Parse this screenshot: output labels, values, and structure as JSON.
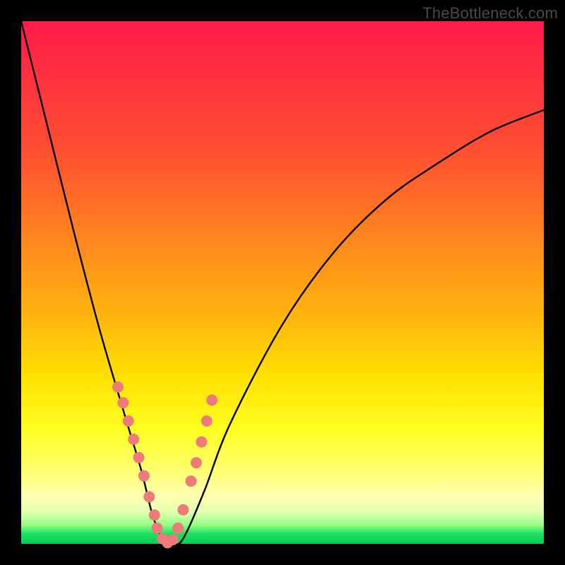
{
  "watermark": "TheBottleneck.com",
  "chart_data": {
    "type": "line",
    "title": "",
    "xlabel": "",
    "ylabel": "",
    "xlim": [
      0,
      100
    ],
    "ylim": [
      0,
      100
    ],
    "series": [
      {
        "name": "bottleneck-curve",
        "x": [
          0,
          5,
          10,
          15,
          20,
          23,
          25,
          27,
          29,
          31,
          35,
          40,
          50,
          60,
          70,
          80,
          90,
          100
        ],
        "values": [
          100,
          80,
          60,
          41,
          24,
          14,
          6,
          1,
          0,
          1,
          10,
          23,
          42,
          56,
          66,
          73,
          79,
          83
        ]
      }
    ],
    "minimum_x": 28,
    "markers": {
      "name": "highlight-dots",
      "color": "#ed7b7b",
      "x": [
        18.5,
        19.5,
        20.5,
        21.5,
        22.5,
        23.5,
        24.5,
        25.5,
        26.0,
        27.0,
        28.0,
        29.0,
        30.0,
        31.0,
        32.5,
        33.5,
        34.5,
        35.5,
        36.5
      ],
      "values": [
        30.0,
        27.0,
        23.5,
        20.0,
        16.5,
        13.0,
        9.0,
        5.5,
        3.0,
        1.0,
        0.2,
        0.8,
        3.0,
        6.5,
        12.0,
        15.5,
        19.5,
        23.5,
        27.5
      ]
    }
  }
}
